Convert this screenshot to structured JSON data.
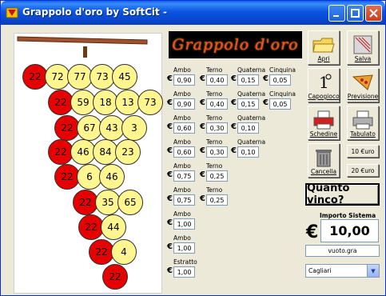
{
  "window": {
    "title": "Grappolo d'oro by SoftCit -"
  },
  "logo_text": "Grappolo d'oro",
  "grape": {
    "rows": [
      [
        {
          "n": "22",
          "c": "red"
        },
        {
          "n": "72",
          "c": "yellow"
        },
        {
          "n": "77",
          "c": "yellow"
        },
        {
          "n": "73",
          "c": "yellow"
        },
        {
          "n": "45",
          "c": "yellow"
        }
      ],
      [
        {
          "n": "22",
          "c": "red"
        },
        {
          "n": "59",
          "c": "yellow"
        },
        {
          "n": "18",
          "c": "yellow"
        },
        {
          "n": "13",
          "c": "yellow"
        },
        {
          "n": "73",
          "c": "yellow"
        }
      ],
      [
        {
          "n": "22",
          "c": "red"
        },
        {
          "n": "67",
          "c": "yellow"
        },
        {
          "n": "43",
          "c": "yellow"
        },
        {
          "n": "3",
          "c": "yellow"
        }
      ],
      [
        {
          "n": "22",
          "c": "red"
        },
        {
          "n": "46",
          "c": "yellow"
        },
        {
          "n": "84",
          "c": "yellow"
        },
        {
          "n": "23",
          "c": "yellow"
        }
      ],
      [
        {
          "n": "22",
          "c": "red"
        },
        {
          "n": "6",
          "c": "yellow"
        },
        {
          "n": "46",
          "c": "yellow"
        }
      ],
      [
        {
          "n": "22",
          "c": "red"
        },
        {
          "n": "35",
          "c": "yellow"
        },
        {
          "n": "65",
          "c": "yellow"
        }
      ],
      [
        {
          "n": "22",
          "c": "red"
        },
        {
          "n": "44",
          "c": "yellow"
        }
      ],
      [
        {
          "n": "22",
          "c": "red"
        },
        {
          "n": "4",
          "c": "yellow"
        }
      ],
      [
        {
          "n": "22",
          "c": "red"
        }
      ]
    ]
  },
  "labels": {
    "ambo": "Ambo",
    "terno": "Terno",
    "quaterna": "Quaterna",
    "cinquina": "Cinquina",
    "estratto": "Estratto",
    "euro": "€"
  },
  "bets": [
    {
      "ambo": "0,90",
      "terno": "0,40",
      "quaterna": "0,15",
      "cinquina": "0,05"
    },
    {
      "ambo": "0,90",
      "terno": "0,40",
      "quaterna": "0,15",
      "cinquina": "0,05"
    },
    {
      "ambo": "0,60",
      "terno": "0,30",
      "quaterna": "0,10"
    },
    {
      "ambo": "0,60",
      "terno": "0,30",
      "quaterna": "0,10"
    },
    {
      "ambo": "0,75",
      "terno": "0,25"
    },
    {
      "ambo": "0,75",
      "terno": "0,25"
    },
    {
      "ambo": "1,00"
    },
    {
      "ambo": "1,00"
    },
    {
      "estratto": "1,00"
    }
  ],
  "toolbar": {
    "apri": "Apri",
    "salva": "Salva",
    "capogioco": "Capogioco",
    "previsione": "Previsione",
    "schedine": "Schedine",
    "tabulato": "Tabulato",
    "cancella": "Cancella",
    "ten_euro": "10 €uro",
    "twenty_euro": "20 €uro"
  },
  "quanto_vinco": "Quanto vinco?",
  "importo": {
    "label": "Importo Sistema",
    "currency": "€",
    "value": "10,00"
  },
  "file_name": "vuoto.gra",
  "city": "Cagliari",
  "colors": {
    "ball_red": "#e60000",
    "ball_yellow": "#fff68f",
    "titlebar": "#0a55e3"
  }
}
